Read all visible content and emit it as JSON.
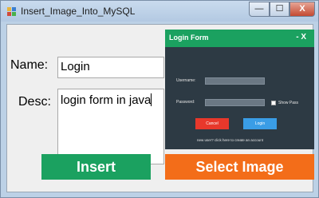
{
  "window": {
    "title": "Insert_Image_Into_MySQL",
    "controls": {
      "minimize": "—",
      "maximize": "☐",
      "close": "X"
    }
  },
  "form": {
    "name_label": "Name:",
    "name_value": "Login",
    "desc_label": "Desc:",
    "desc_value": "login form in java",
    "insert_button": "Insert",
    "select_image_button": "Select Image"
  },
  "preview": {
    "title": "Login Form",
    "controls": "-  X",
    "username_label": "Username:",
    "password_label": "Password:",
    "show_pass_label": "Show Pass",
    "cancel_button": "Cancel",
    "login_button": "Login",
    "new_user_text": "new user? click here to create an account"
  },
  "colors": {
    "green": "#1ba160",
    "orange": "#f36d19",
    "preview_bg": "#2d3a44"
  }
}
